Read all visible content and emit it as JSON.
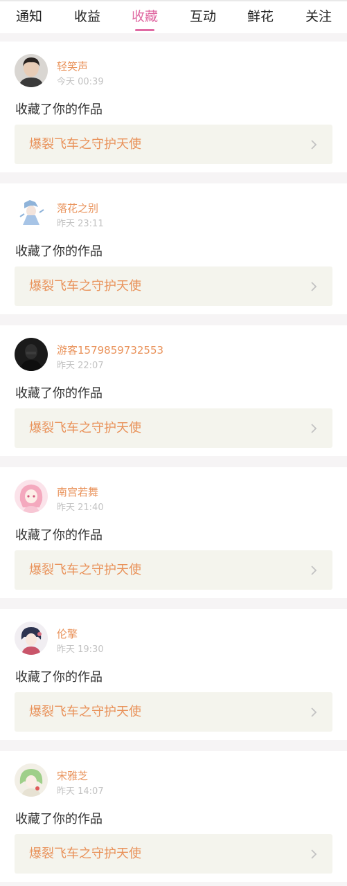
{
  "tabs": [
    {
      "label": "通知",
      "active": false
    },
    {
      "label": "收益",
      "active": false
    },
    {
      "label": "收藏",
      "active": true
    },
    {
      "label": "互动",
      "active": false
    },
    {
      "label": "鲜花",
      "active": false
    },
    {
      "label": "关注",
      "active": false
    }
  ],
  "colors": {
    "accent": "#e06aa3",
    "username": "#e9925a",
    "work_title": "#e9925a",
    "card_bg": "#ffffff",
    "work_bg": "#f4f4ed",
    "page_bg": "#f6f4f5"
  },
  "notifications": [
    {
      "user": "轻笑声",
      "time": "今天 00:39",
      "action": "收藏了你的作品",
      "work": "爆裂飞车之守护天使",
      "avatar_icon": "avatar-boy-icon"
    },
    {
      "user": "落花之别",
      "time": "昨天 23:11",
      "action": "收藏了你的作品",
      "work": "爆裂飞车之守护天使",
      "avatar_icon": "avatar-anime-blue-icon"
    },
    {
      "user": "游客1579859732553",
      "time": "昨天 22:07",
      "action": "收藏了你的作品",
      "work": "爆裂飞车之守护天使",
      "avatar_icon": "avatar-dark-icon"
    },
    {
      "user": "南宫若舞",
      "time": "昨天 21:40",
      "action": "收藏了你的作品",
      "work": "爆裂飞车之守护天使",
      "avatar_icon": "avatar-anime-pink-icon"
    },
    {
      "user": "伦擎",
      "time": "昨天 19:30",
      "action": "收藏了你的作品",
      "work": "爆裂飞车之守护天使",
      "avatar_icon": "avatar-anime-dark-hair-icon"
    },
    {
      "user": "宋雅芝",
      "time": "昨天 14:07",
      "action": "收藏了你的作品",
      "work": "爆裂飞车之守护天使",
      "avatar_icon": "avatar-anime-green-icon"
    }
  ]
}
